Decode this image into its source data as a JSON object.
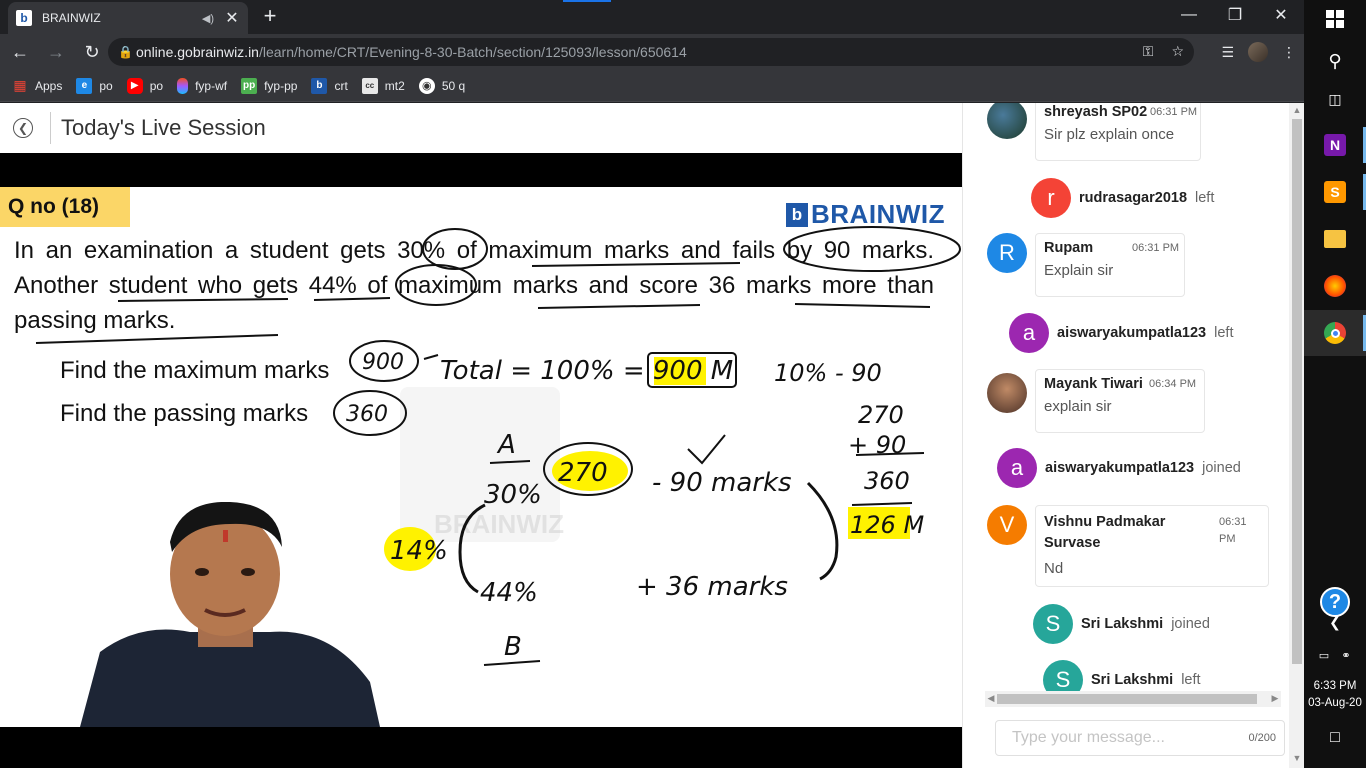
{
  "browser": {
    "tab_title": "BRAINWIZ",
    "tab_favicon": "b",
    "tab_audio_icon": "speaker-icon",
    "url_host": "online.gobrainwiz.in",
    "url_path": "/learn/home/CRT/Evening-8-30-Batch/section/125093/lesson/650614",
    "bookmarks": [
      {
        "label": "Apps",
        "icon": "apps-grid-icon",
        "color": "#ea4335"
      },
      {
        "label": "po",
        "icon": "ie-icon",
        "color": "#1e88e5"
      },
      {
        "label": "po",
        "icon": "youtube-icon",
        "color": "#ff0000"
      },
      {
        "label": "fyp-wf",
        "icon": "figma-icon",
        "color": "#a259ff"
      },
      {
        "label": "fyp-pp",
        "icon": "paper-icon",
        "color": "#4caf50"
      },
      {
        "label": "crt",
        "icon": "brainwiz-icon",
        "color": "#1f58a8"
      },
      {
        "label": "mt2",
        "icon": "cc-icon",
        "color": "#e8e8e8"
      },
      {
        "label": "50 q",
        "icon": "globe-icon",
        "color": "#ffffff"
      }
    ]
  },
  "header": {
    "title": "Today's Live Session"
  },
  "slide": {
    "qno": "Q no (18)",
    "logo": "BRAINWIZ",
    "logo_mark": "b",
    "question": "In an examination a student gets 30% of maximum marks and fails by 90 marks. Another student who gets 44% of maximum marks and score 36 marks more than passing marks.",
    "line1": "Find the maximum marks",
    "line2": "Find the passing marks",
    "watermark": "BRAINWIZ",
    "handwriting": {
      "ans_max": "900",
      "ans_pass": "360",
      "total": "Total = 100% = 900 M",
      "ten_pct": "10% - 90",
      "label_a": "A",
      "pct_30": "30%",
      "val_270": "270",
      "minus_90": "- 90 marks",
      "add_270": "270",
      "add_90": "+ 90",
      "add_360": "360",
      "val_126": "126 M",
      "pct_14": "14%",
      "pct_44": "44%",
      "plus_36": "+ 36 marks",
      "label_b": "B"
    }
  },
  "chat": {
    "messages": [
      {
        "type": "msg",
        "name": "shreyash SP02",
        "time": "06:31 PM",
        "text": "Sir plz explain once",
        "avatar": "photo"
      },
      {
        "type": "event",
        "name": "rudrasagar2018",
        "status": "left",
        "initial": "r",
        "color": "#f44336"
      },
      {
        "type": "msg",
        "name": "Rupam",
        "time": "06:31 PM",
        "text": "Explain sir",
        "initial": "R",
        "color": "#1e88e5"
      },
      {
        "type": "event",
        "name": "aiswaryakumpatla123",
        "status": "left",
        "initial": "a",
        "color": "#9c27b0"
      },
      {
        "type": "msg",
        "name": "Mayank Tiwari",
        "time": "06:34 PM",
        "text": "explain sir",
        "avatar": "photo"
      },
      {
        "type": "event",
        "name": "aiswaryakumpatla123",
        "status": "joined",
        "initial": "a",
        "color": "#9c27b0"
      },
      {
        "type": "msg",
        "name": "Vishnu Padmakar Survase",
        "time": "06:31 PM",
        "text": "Nd",
        "initial": "V",
        "color": "#f57c00"
      },
      {
        "type": "event",
        "name": "Sri Lakshmi",
        "status": "joined",
        "initial": "S",
        "color": "#26a69a"
      },
      {
        "type": "event",
        "name": "Sri Lakshmi",
        "status": "left",
        "initial": "S",
        "color": "#26a69a"
      }
    ],
    "input_placeholder": "Type your message...",
    "char_count": "0/200"
  },
  "taskbar": {
    "time": "6:33 PM",
    "date": "03-Aug-20",
    "help_icon": "?"
  }
}
